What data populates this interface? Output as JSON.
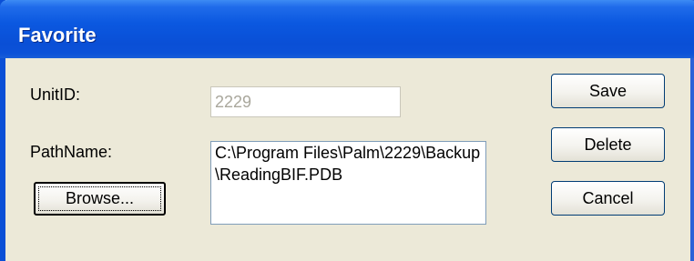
{
  "window": {
    "title": "Favorite"
  },
  "form": {
    "unitid_label": "UnitID:",
    "unitid_value": "2229",
    "pathname_label": "PathName:",
    "pathname_value": "C:\\Program Files\\Palm\\2229\\Backup\\ReadingBIF.PDB",
    "browse_label": "Browse..."
  },
  "buttons": {
    "save_label": "Save",
    "delete_label": "Delete",
    "cancel_label": "Cancel"
  },
  "colors": {
    "titlebar": "#0a4fd6",
    "dialog_bg": "#ece9d8",
    "disabled_text": "#a9a79c"
  }
}
